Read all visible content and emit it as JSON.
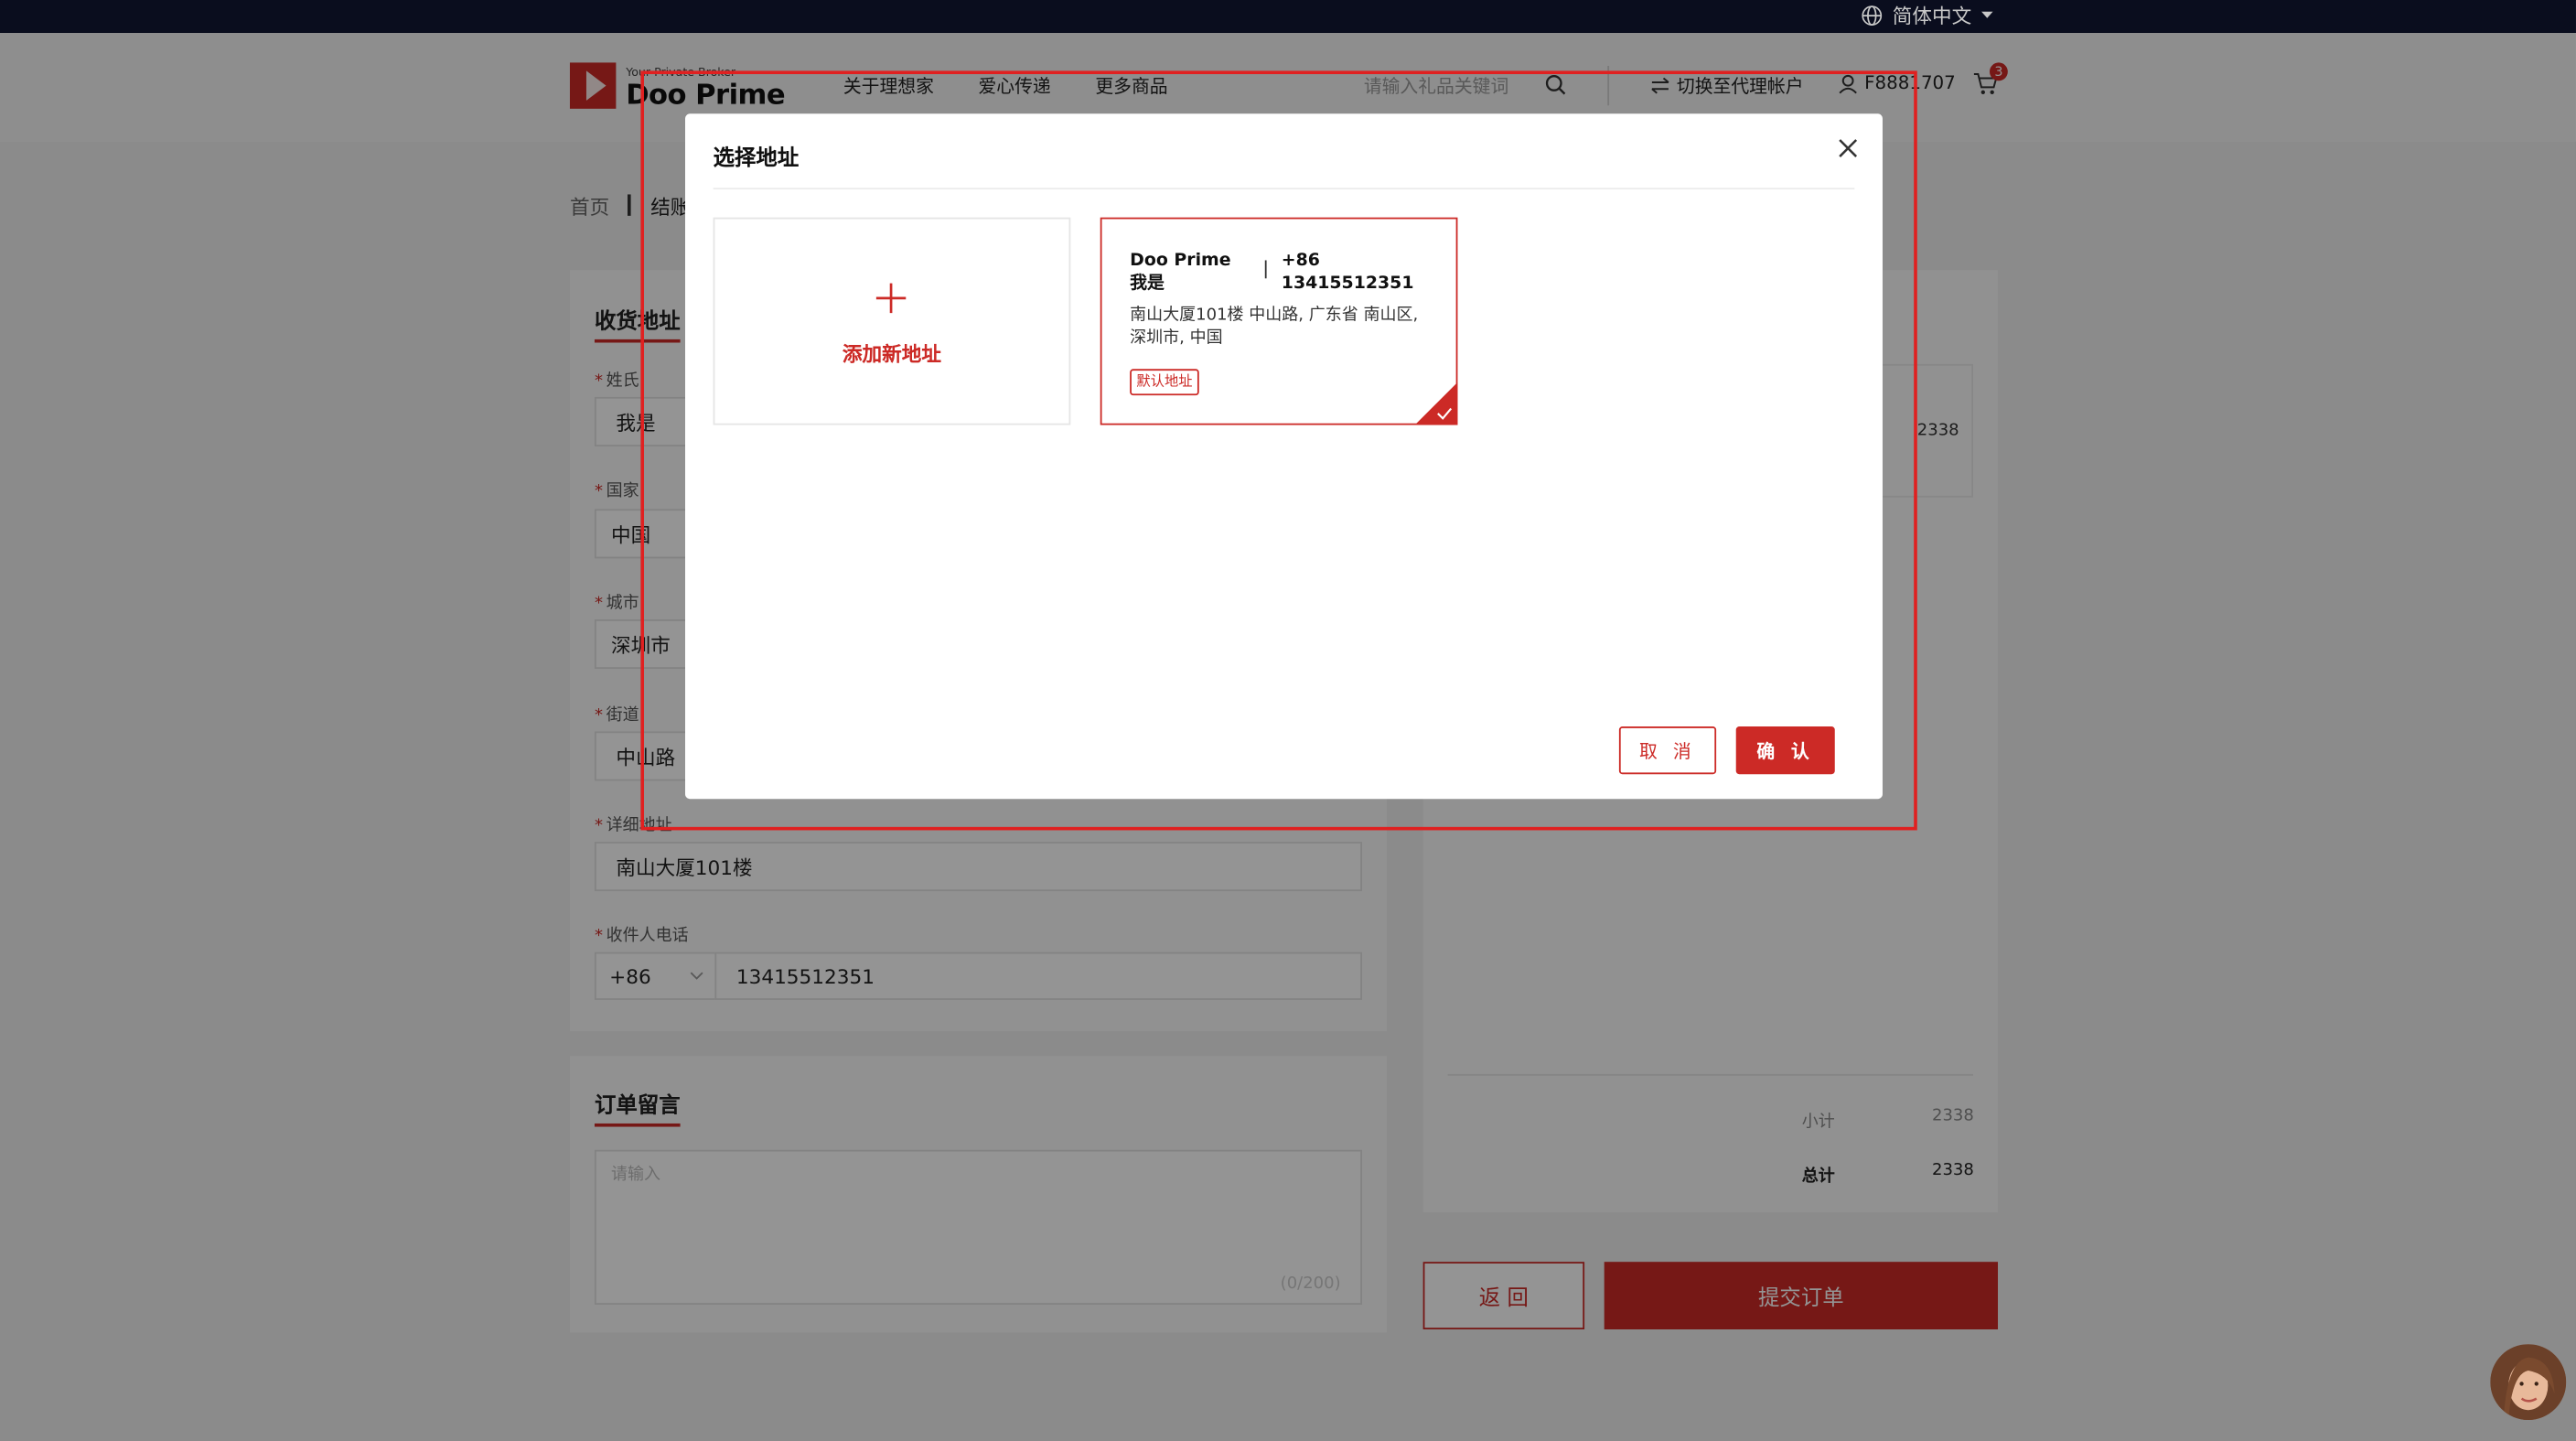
{
  "topbar": {
    "language": "简体中文"
  },
  "header": {
    "logo_tagline": "Your Private Broker",
    "logo_name": "Doo Prime",
    "nav": [
      "关于理想家",
      "爱心传递",
      "更多商品"
    ],
    "search_placeholder": "请输入礼品关键词",
    "switch_label": "切换至代理帐户",
    "user_id": "F8881707",
    "cart_count": "3"
  },
  "breadcrumb": {
    "home": "首页",
    "current": "结账"
  },
  "shipping": {
    "title": "收货地址",
    "fields": [
      {
        "label": "姓氏",
        "value": "我是"
      },
      {
        "label": "国家",
        "value": "中国"
      },
      {
        "label": "城市",
        "value": "深圳市"
      },
      {
        "label": "街道",
        "value": "中山路"
      },
      {
        "label": "详细地址",
        "value": "南山大厦101楼"
      },
      {
        "label": "收件人电话",
        "code": "+86",
        "value": "13415512351"
      }
    ]
  },
  "order_note": {
    "title": "订单留言",
    "placeholder": "请输入",
    "counter": "(0/200)"
  },
  "summary": {
    "item_price": "2338",
    "subtotal_label": "小计",
    "subtotal": "2338",
    "total_label": "总计",
    "total": "2338"
  },
  "actions": {
    "back": "返 回",
    "submit": "提交订单"
  },
  "modal": {
    "title": "选择地址",
    "add_new": "添加新地址",
    "address": {
      "name": "Doo Prime 我是",
      "phone": "+86 13415512351",
      "line": "南山大厦101楼 中山路, 广东省 南山区, 深圳市, 中国",
      "badge": "默认地址"
    },
    "cancel": "取 消",
    "confirm": "确 认"
  },
  "colors": {
    "brand": "#cc2a26",
    "topbar": "#0a0d1e",
    "highlight": "#e02020"
  }
}
